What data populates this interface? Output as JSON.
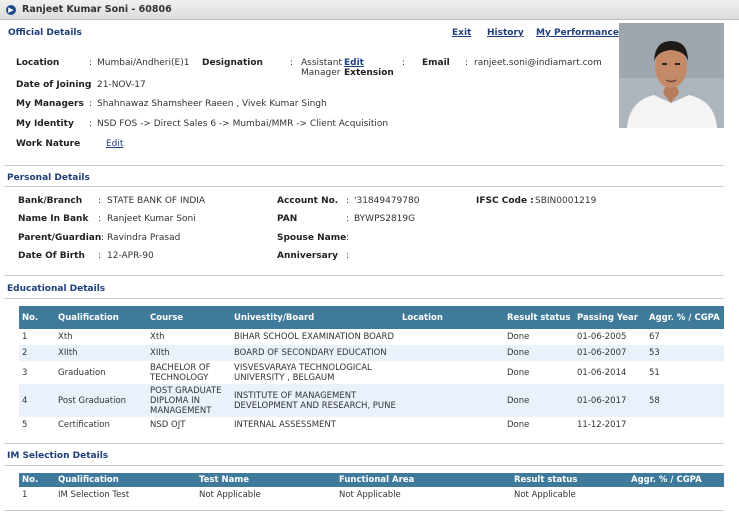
{
  "header": {
    "title": "Ranjeet Kumar Soni - 60806"
  },
  "top_links": {
    "exit": "Exit",
    "history": "History",
    "performance": "My Performance"
  },
  "official": {
    "section_title": "Official Details",
    "location_label": "Location",
    "location_value": "Mumbai/Andheri(E)1",
    "designation_label": "Designation",
    "designation_value_line1": "Assistant",
    "designation_value_line2": "Manager",
    "edit_extension_label1": "Edit",
    "edit_extension_label2": "Extension",
    "email_label": "Email",
    "email_value": "ranjeet.soni@indiamart.com",
    "doj_label": "Date of Joining",
    "doj_value": "21-NOV-17",
    "managers_label": "My Managers",
    "managers_value": "Shahnawaz Shamsheer Raeen , Vivek Kumar Singh",
    "identity_label": "My Identity",
    "identity_value": "NSD FOS -> Direct Sales 6 -> Mumbai/MMR -> Client Acquisition",
    "work_nature_label": "Work Nature",
    "work_nature_edit": "Edit"
  },
  "personal": {
    "section_title": "Personal Details",
    "bank_label": "Bank/Branch",
    "bank_value": "STATE BANK OF INDIA",
    "account_label": "Account No.",
    "account_value": "'31849479780",
    "ifsc_label": "IFSC Code :",
    "ifsc_value": "SBIN0001219",
    "name_bank_label": "Name In Bank",
    "name_bank_value": "Ranjeet Kumar Soni",
    "pan_label": "PAN",
    "pan_value": "BYWPS2819G",
    "guardian_label": "Parent/Guardian",
    "guardian_value": "Ravindra Prasad",
    "spouse_label": "Spouse Name",
    "spouse_value": "",
    "dob_label": "Date Of Birth",
    "dob_value": "12-APR-90",
    "anniversary_label": "Anniversary",
    "anniversary_value": ""
  },
  "education": {
    "section_title": "Educational Details",
    "headers": [
      "No.",
      "Qualification",
      "Course",
      "Univestity/Board",
      "Location",
      "Result status",
      "Passing Year",
      "Aggr. % / CGPA"
    ],
    "rows": [
      [
        "1",
        "Xth",
        "Xth",
        "BIHAR SCHOOL EXAMINATION BOARD",
        "",
        "Done",
        "01-06-2005",
        "67"
      ],
      [
        "2",
        "XIIth",
        "XIIth",
        "BOARD OF SECONDARY EDUCATION",
        "",
        "Done",
        "01-06-2007",
        "53"
      ],
      [
        "3",
        "Graduation",
        "BACHELOR OF TECHNOLOGY",
        "VISVESVARAYA TECHNOLOGICAL UNIVERSITY , BELGAUM",
        "",
        "Done",
        "01-06-2014",
        "51"
      ],
      [
        "4",
        "Post Graduation",
        "POST GRADUATE DIPLOMA IN MANAGEMENT",
        "INSTITUTE OF MANAGEMENT DEVELOPMENT AND RESEARCH, PUNE",
        "",
        "Done",
        "01-06-2017",
        "58"
      ],
      [
        "5",
        "Certification",
        "NSD OJT",
        "INTERNAL ASSESSMENT",
        "",
        "Done",
        "11-12-2017",
        ""
      ]
    ]
  },
  "im_selection": {
    "section_title": "IM Selection Details",
    "headers": [
      "No.",
      "Qualification",
      "Test Name",
      "Functional Area",
      "Result status",
      "Aggr. % / CGPA"
    ],
    "rows": [
      [
        "1",
        "IM Selection Test",
        "Not Applicable",
        "Not Applicable",
        "Not Applicable",
        ""
      ]
    ]
  }
}
